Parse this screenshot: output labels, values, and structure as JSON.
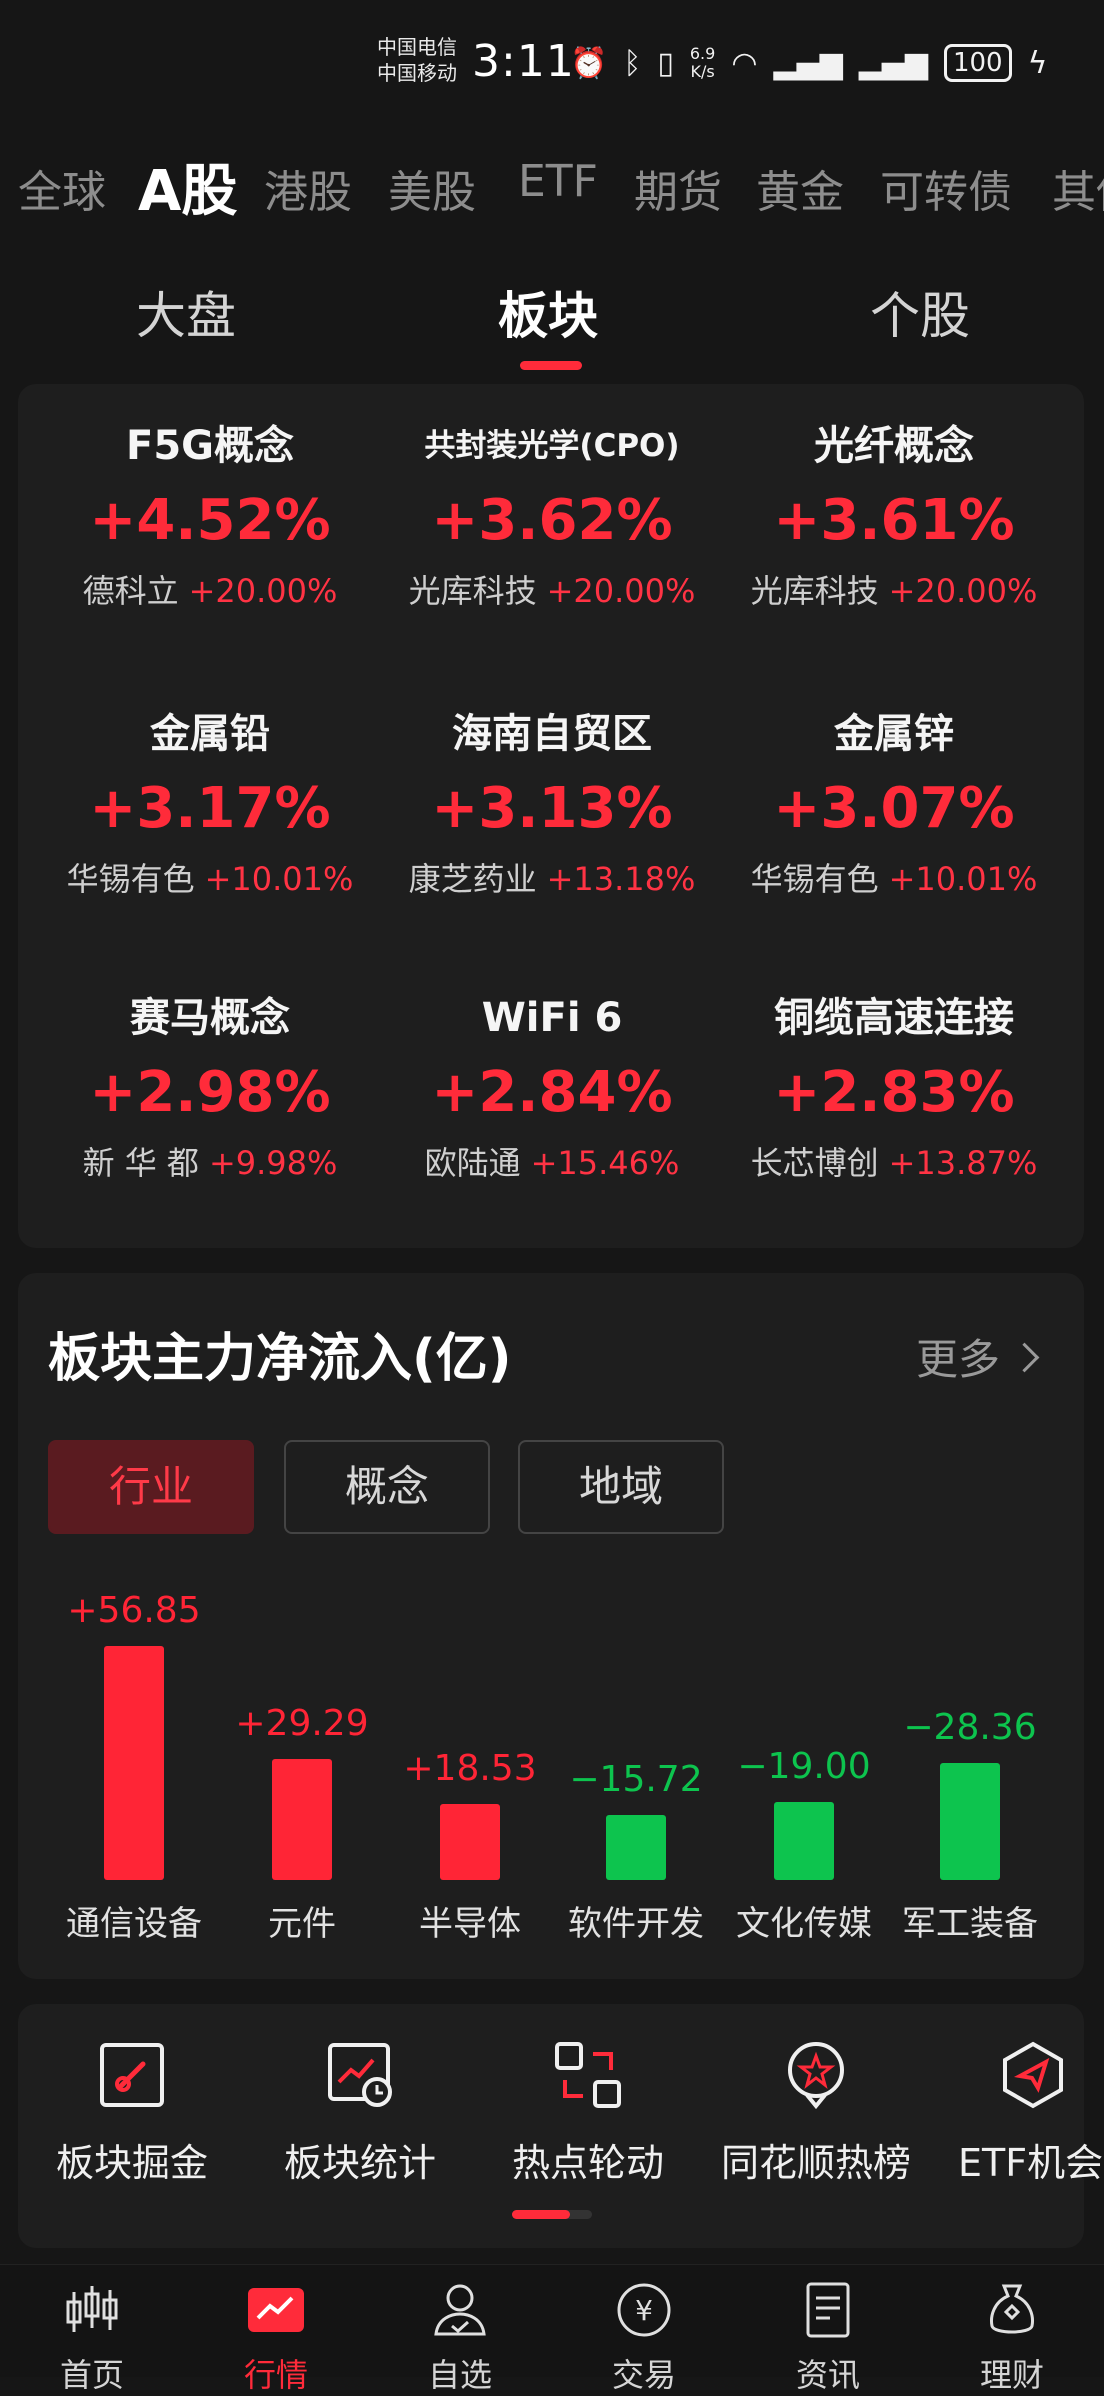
{
  "status_bar": {
    "carrier1": "中国电信",
    "carrier2": "中国移动",
    "time": "3:11",
    "speed_value": "6.9",
    "speed_unit": "K/s",
    "battery": "100"
  },
  "market_tabs": [
    "全球",
    "A股",
    "港股",
    "美股",
    "ETF",
    "期货",
    "黄金",
    "可转债",
    "其他"
  ],
  "sub_tabs": [
    "大盘",
    "板块",
    "个股"
  ],
  "sectors": [
    {
      "name": "F5G概念",
      "pct": "+4.52%",
      "leader": "德科立",
      "leader_pct": "+20.00%"
    },
    {
      "name": "共封装光学(CPO)",
      "pct": "+3.62%",
      "leader": "光库科技",
      "leader_pct": "+20.00%"
    },
    {
      "name": "光纤概念",
      "pct": "+3.61%",
      "leader": "光库科技",
      "leader_pct": "+20.00%"
    },
    {
      "name": "金属铅",
      "pct": "+3.17%",
      "leader": "华锡有色",
      "leader_pct": "+10.01%"
    },
    {
      "name": "海南自贸区",
      "pct": "+3.13%",
      "leader": "康芝药业",
      "leader_pct": "+13.18%"
    },
    {
      "name": "金属锌",
      "pct": "+3.07%",
      "leader": "华锡有色",
      "leader_pct": "+10.01%"
    },
    {
      "name": "赛马概念",
      "pct": "+2.98%",
      "leader": "新 华 都",
      "leader_pct": "+9.98%"
    },
    {
      "name": "WiFi 6",
      "pct": "+2.84%",
      "leader": "欧陆通",
      "leader_pct": "+15.46%"
    },
    {
      "name": "铜缆高速连接",
      "pct": "+2.83%",
      "leader": "长芯博创",
      "leader_pct": "+13.87%"
    }
  ],
  "flow": {
    "title": "板块主力净流入(亿)",
    "more": "更多",
    "tabs": [
      "行业",
      "概念",
      "地域"
    ]
  },
  "chart_data": {
    "type": "bar",
    "categories": [
      "通信设备",
      "元件",
      "半导体",
      "软件开发",
      "文化传媒",
      "军工装备"
    ],
    "values": [
      56.85,
      29.29,
      18.53,
      -15.72,
      -19.0,
      -28.36
    ],
    "value_labels": [
      "+56.85",
      "+29.29",
      "+18.53",
      "−15.72",
      "−19.00",
      "−28.36"
    ],
    "colors": {
      "positive": "#ff2536",
      "negative": "#0dc44e"
    }
  },
  "tools": [
    {
      "label": "板块掘金",
      "icon": "sector-dig-icon"
    },
    {
      "label": "板块统计",
      "icon": "sector-stats-icon"
    },
    {
      "label": "热点轮动",
      "icon": "hotspot-rotation-icon"
    },
    {
      "label": "同花顺热榜",
      "icon": "hot-list-icon"
    },
    {
      "label": "ETF机会",
      "icon": "etf-opportunity-icon"
    }
  ],
  "bottom_nav": [
    {
      "label": "首页",
      "icon": "candlestick-icon"
    },
    {
      "label": "行情",
      "icon": "market-chart-icon"
    },
    {
      "label": "自选",
      "icon": "person-check-icon"
    },
    {
      "label": "交易",
      "icon": "yen-coin-icon"
    },
    {
      "label": "资讯",
      "icon": "document-icon"
    },
    {
      "label": "理财",
      "icon": "money-bag-icon"
    }
  ],
  "colors": {
    "accent": "#ff2b3a",
    "up": "#ff2b3a",
    "down": "#0dc44e",
    "background": "#161616",
    "card": "#1e1e1e"
  }
}
